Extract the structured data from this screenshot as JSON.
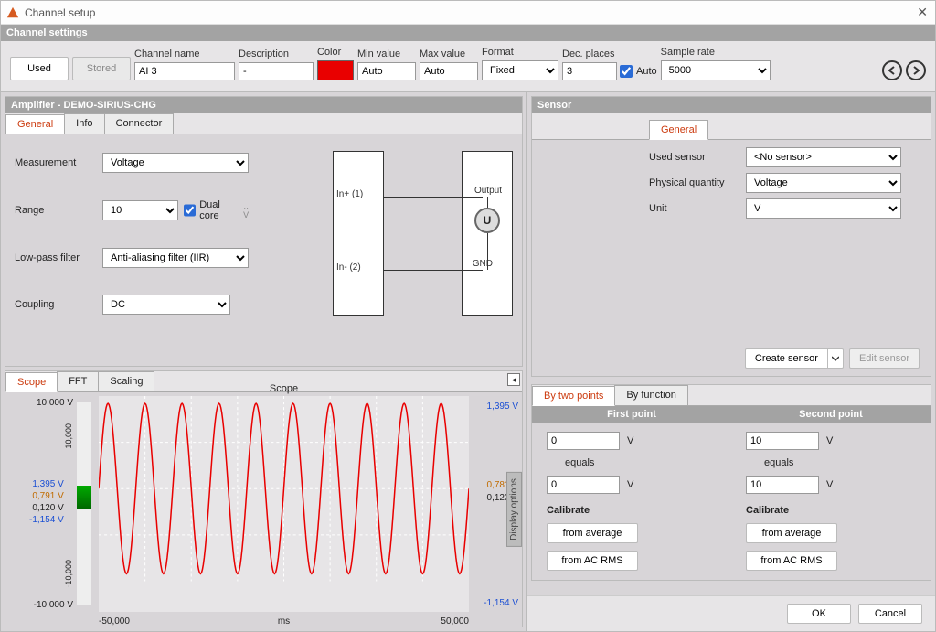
{
  "window": {
    "title": "Channel setup"
  },
  "section_headers": {
    "channel_settings": "Channel settings",
    "amplifier": "Amplifier - DEMO-SIRIUS-CHG",
    "sensor": "Sensor"
  },
  "toolbar": {
    "used": "Used",
    "stored": "Stored",
    "channel_name_label": "Channel name",
    "channel_name": "AI 3",
    "description_label": "Description",
    "description": "-",
    "color_label": "Color",
    "color": "#e90000",
    "min_label": "Min value",
    "min_value": "Auto",
    "max_label": "Max value",
    "max_value": "Auto",
    "format_label": "Format",
    "format": "Fixed",
    "dec_label": "Dec. places",
    "dec_places": "3",
    "auto_label": "Auto",
    "sample_label": "Sample rate",
    "sample_rate": "5000"
  },
  "amp_tabs": {
    "general": "General",
    "info": "Info",
    "connector": "Connector"
  },
  "amp_form": {
    "measurement_label": "Measurement",
    "measurement": "Voltage",
    "range_label": "Range",
    "range": "10",
    "dual_core": "Dual core",
    "lpf_label": "Low-pass filter",
    "lpf": "Anti-aliasing filter (IIR)",
    "coupling_label": "Coupling",
    "coupling": "DC"
  },
  "diagram": {
    "in_plus": "In+ (1)",
    "in_minus": "In- (2)",
    "output": "Output",
    "gnd": "GND",
    "symbol": "U"
  },
  "sensor_tabs": {
    "general": "General"
  },
  "sensor_form": {
    "used_label": "Used sensor",
    "used": "<No sensor>",
    "pq_label": "Physical quantity",
    "pq": "Voltage",
    "unit_label": "Unit",
    "unit": "V"
  },
  "sensor_actions": {
    "create": "Create sensor",
    "edit": "Edit sensor"
  },
  "scope_tabs": {
    "scope": "Scope",
    "fft": "FFT",
    "scaling": "Scaling"
  },
  "scope": {
    "title": "Scope",
    "y_top": "10,000 V",
    "y_bot": "-10,000 V",
    "y_side_top": "10,000",
    "y_side_bot": "-10,000",
    "x_left": "-50,000",
    "x_right": "50,000",
    "x_mid": "ms",
    "ind1": "1,395 V",
    "ind2": "0,791 V",
    "ind3": "0,120 V",
    "ind4": "-1,154 V",
    "r1": "1,395 V",
    "r2": "0,781 V",
    "r3": "0,123 V",
    "r4": "-1,154 V",
    "display_options": "Display options"
  },
  "calib_tabs": {
    "two": "By two points",
    "func": "By function"
  },
  "calib": {
    "first": "First point",
    "second": "Second point",
    "p1a": "0",
    "p1a_unit": "V",
    "equals": "equals",
    "p1b": "0",
    "p1b_unit": "V",
    "p2a": "10",
    "p2a_unit": "V",
    "p2b": "10",
    "p2b_unit": "V",
    "calibrate": "Calibrate",
    "from_avg": "from average",
    "from_rms": "from AC RMS"
  },
  "dialog": {
    "ok": "OK",
    "cancel": "Cancel"
  },
  "chart_data": {
    "type": "line",
    "title": "Scope",
    "xlabel": "ms",
    "ylabel": "V",
    "xlim": [
      -50000,
      50000
    ],
    "ylim": [
      -10000,
      10000
    ],
    "full_scale_ylim": [
      -10000,
      10000
    ],
    "zoom_min": -1.154,
    "zoom_max": 1.395,
    "avg_high": 0.781,
    "avg_low": 0.123,
    "series": [
      {
        "name": "AI 3",
        "color": "#e90000",
        "approx_period_ms": 10000,
        "approx_amplitude_V": 1.3,
        "description": "≈10 cycles of a near-sine wave between −1.154 V and 1.395 V"
      }
    ]
  }
}
